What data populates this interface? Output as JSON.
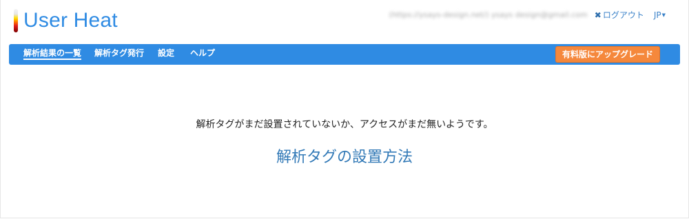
{
  "app": {
    "name": "User Heat"
  },
  "header": {
    "email": "(https://ysays-design.net/) ysays design@gmail.com",
    "logout_label": "ログアウト",
    "language_label": "JP"
  },
  "nav": {
    "items": [
      {
        "label": "解析結果の一覧",
        "active": true
      },
      {
        "label": "解析タグ発行",
        "active": false
      },
      {
        "label": "設定",
        "active": false
      },
      {
        "label": "ヘルプ",
        "active": false
      }
    ],
    "upgrade_label": "有料版にアップグレード"
  },
  "main": {
    "message": "解析タグがまだ設置されていないか、アクセスがまだ無いようです。",
    "howto_link": "解析タグの設置方法"
  },
  "colors": {
    "accent": "#2f8be3",
    "upgrade": "#f5883c",
    "link": "#337ab7"
  }
}
